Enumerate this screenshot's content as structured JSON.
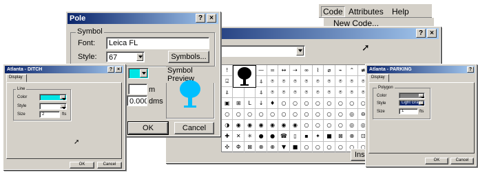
{
  "menubar": {
    "items": [
      "Code",
      "Attributes",
      "Help"
    ],
    "dropdown_item": "New Code..."
  },
  "symbols_window": {
    "title_fragment": "l",
    "insert_label": "Inse",
    "symbol_rows": [
      [
        "!",
        "",
        "",
        "—",
        "=",
        "↔",
        "⇢",
        "∞",
        "⌇",
        "⌀",
        "⌁",
        "⌃",
        "≢"
      ],
      [
        "⍃",
        "",
        "",
        "⍋",
        "⍟",
        "⍟",
        "⍟",
        "⍟",
        "⍟",
        "⍟",
        "⍟",
        "⍟",
        "⍟"
      ],
      [
        "⍋",
        "",
        "",
        "⍋",
        "⍟",
        "⍟",
        "⍟",
        "⍟",
        "⍟",
        "⍟",
        "⍟",
        "⍟",
        "⍟"
      ],
      [
        "▣",
        "⊞",
        "L",
        "↓",
        "♦",
        "○",
        "○",
        "○",
        "○",
        "○",
        "○",
        "○",
        "○"
      ],
      [
        "○",
        "○",
        "○",
        "○",
        "○",
        "○",
        "○",
        "○",
        "○",
        "○",
        "○",
        "◎",
        "⊖"
      ],
      [
        "◑",
        "◉",
        "◉",
        "◉",
        "◉",
        "◉",
        "◉",
        "○",
        "○",
        "○",
        "○",
        "◎",
        "◎"
      ],
      [
        "✚",
        "✕",
        "✳",
        "●",
        "●",
        "☎",
        "▯",
        "▪",
        "✦",
        "■",
        "⊠",
        "⊗",
        "⊡"
      ],
      [
        "✣",
        "Φ",
        "⊠",
        "⊗",
        "⊕",
        "▼",
        "■",
        "○",
        "○",
        "○",
        "○",
        "○",
        "○"
      ]
    ]
  },
  "pole_dialog": {
    "title": "Pole",
    "help_btn": "?",
    "close_btn": "×",
    "symbol_group": "Symbol",
    "font_label": "Font:",
    "font_value": "Leica FL",
    "style_label": "Style:",
    "style_value": "67",
    "symbols_button": "Symbols...",
    "preview_label": "Symbol Preview",
    "unit_m": "m",
    "rotation_value": "0.0000",
    "unit_dms": "dms",
    "ok": "OK",
    "cancel": "Cancel"
  },
  "ditch_dialog": {
    "title": "Atlanta - DITCH",
    "help_btn": "?",
    "close_btn": "×",
    "tab": "Display",
    "group": "Line",
    "color_label": "Color",
    "style_label": "Style",
    "size_label": "Size",
    "size_value": "2",
    "size_unit": "fts",
    "ok": "OK",
    "cancel": "Cancel",
    "color_hex": "#00e5e5"
  },
  "parking_dialog": {
    "title": "Atlanta - PARKING",
    "help_btn": "?",
    "tab": "Display",
    "group": "Polygon",
    "color_label": "Color",
    "style_label": "Style",
    "size_label": "Size",
    "style_value": "Light Gray",
    "size_value": "1",
    "size_unit": "fts",
    "ok": "OK",
    "cancel": "Cancel",
    "color_hex": "#808080"
  },
  "colors": {
    "title_start": "#0a246a",
    "title_end": "#a6caf0",
    "face": "#d4d0c8",
    "preview": "#00bfff"
  }
}
